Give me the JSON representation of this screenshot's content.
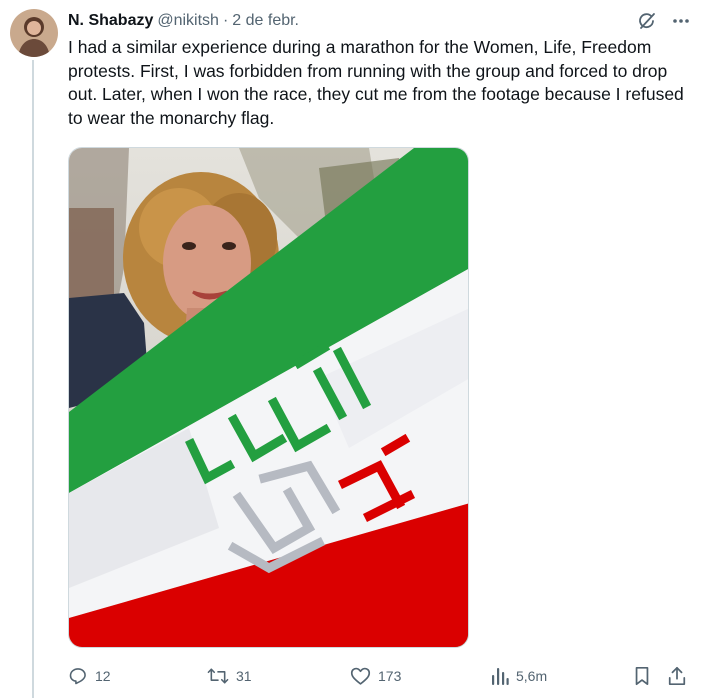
{
  "tweet": {
    "author_name": "N. Shabazy",
    "handle": "@nikitsh",
    "separator": "·",
    "time": "2 de febr.",
    "text": "I had a similar experience during a marathon for the Women, Life, Freedom protests. First, I was forbidden from running with the group and forced to drop out. Later, when I won the race, they cut me from the footage because I refused to wear the monarchy flag."
  },
  "media": {
    "image_icon": "photo-woman-with-flag",
    "flag_colors": {
      "green": "#239f40",
      "white": "#f4f5f7",
      "red": "#da0000"
    },
    "emblem_text": "آزادی زن"
  },
  "actions": {
    "reply_count": "12",
    "repost_count": "31",
    "like_count": "173",
    "views_count": "5,6m"
  },
  "colors": {
    "text": "#0f1419",
    "muted": "#536471",
    "divider": "#cfd9de"
  }
}
